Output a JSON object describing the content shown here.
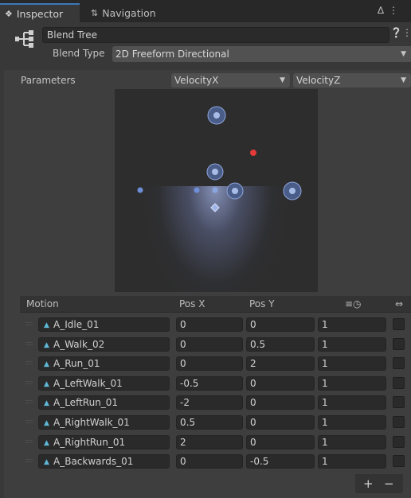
{
  "tabs": [
    {
      "label": "Inspector",
      "icon": "info-icon"
    },
    {
      "label": "Navigation",
      "icon": "navigation-icon"
    }
  ],
  "header": {
    "name": "Blend Tree",
    "blend_type_label": "Blend Type",
    "blend_type_value": "2D Freeform Directional"
  },
  "parameters": {
    "label": "Parameters",
    "x_param": "VelocityX",
    "y_param": "VelocityZ"
  },
  "columns": {
    "motion": "Motion",
    "pos_x": "Pos X",
    "pos_y": "Pos Y"
  },
  "motions": [
    {
      "name": "A_Idle_01",
      "pos_x": "0",
      "pos_y": "0",
      "speed": "1"
    },
    {
      "name": "A_Walk_02",
      "pos_x": "0",
      "pos_y": "0.5",
      "speed": "1"
    },
    {
      "name": "A_Run_01",
      "pos_x": "0",
      "pos_y": "2",
      "speed": "1"
    },
    {
      "name": "A_LeftWalk_01",
      "pos_x": "-0.5",
      "pos_y": "0",
      "speed": "1"
    },
    {
      "name": "A_LeftRun_01",
      "pos_x": "-2",
      "pos_y": "0",
      "speed": "1"
    },
    {
      "name": "A_RightWalk_01",
      "pos_x": "0.5",
      "pos_y": "0",
      "speed": "1"
    },
    {
      "name": "A_RightRun_01",
      "pos_x": "2",
      "pos_y": "0",
      "speed": "1"
    },
    {
      "name": "A_Backwards_01",
      "pos_x": "0",
      "pos_y": "-0.5",
      "speed": "1"
    }
  ],
  "colors": {
    "accent_blue": "#3a79bb",
    "sample_point": "#6e8fd8",
    "parameter_point": "#e03a3a",
    "panel": "#3e3e3e"
  },
  "footer": {
    "add": "+",
    "remove": "−"
  }
}
